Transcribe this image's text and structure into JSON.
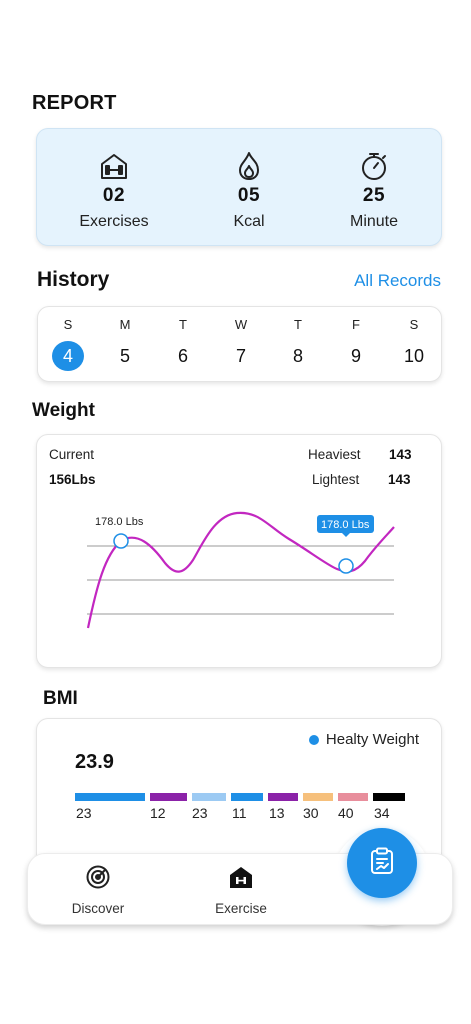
{
  "report": {
    "title": "REPORT",
    "stats": [
      {
        "icon": "gym-icon",
        "value": "02",
        "label": "Exercises"
      },
      {
        "icon": "flame-icon",
        "value": "05",
        "label": "Kcal"
      },
      {
        "icon": "stopwatch-icon",
        "value": "25",
        "label": "Minute"
      }
    ]
  },
  "history": {
    "title": "History",
    "all_records_label": "All Records",
    "days": [
      {
        "name": "S",
        "date": "4",
        "active": true
      },
      {
        "name": "M",
        "date": "5"
      },
      {
        "name": "T",
        "date": "6"
      },
      {
        "name": "W",
        "date": "7"
      },
      {
        "name": "T",
        "date": "8"
      },
      {
        "name": "F",
        "date": "9"
      },
      {
        "name": "S",
        "date": "10"
      }
    ]
  },
  "weight": {
    "title": "Weight",
    "current_label": "Current",
    "current_value": "156Lbs",
    "heaviest_label": "Heaviest",
    "heaviest_value": "143",
    "lightest_label": "Lightest",
    "lightest_value": "143",
    "point_label_1": "178.0 Lbs",
    "point_label_2": "178.0 Lbs",
    "colors": {
      "line": "#c227c0",
      "grid": "#9a9a9a",
      "tooltip": "#1e8fe6",
      "marker": "#1e8fe6"
    }
  },
  "bmi": {
    "title": "BMI",
    "legend_label": "Healty Weight",
    "value": "23.9",
    "segments": [
      {
        "label": "23",
        "color": "#1e8fe6"
      },
      {
        "label": "12",
        "color": "#8b22a8"
      },
      {
        "label": "23",
        "color": "#9ccaf3"
      },
      {
        "label": "11",
        "color": "#1e8fe6"
      },
      {
        "label": "13",
        "color": "#8b22a8"
      },
      {
        "label": "30",
        "color": "#f6c07c"
      },
      {
        "label": "40",
        "color": "#e88e9c"
      },
      {
        "label": "34",
        "color": "#000000"
      }
    ]
  },
  "nav": {
    "discover_label": "Discover",
    "exercise_label": "Exercise",
    "fab_icon": "clipboard-chart-icon"
  }
}
